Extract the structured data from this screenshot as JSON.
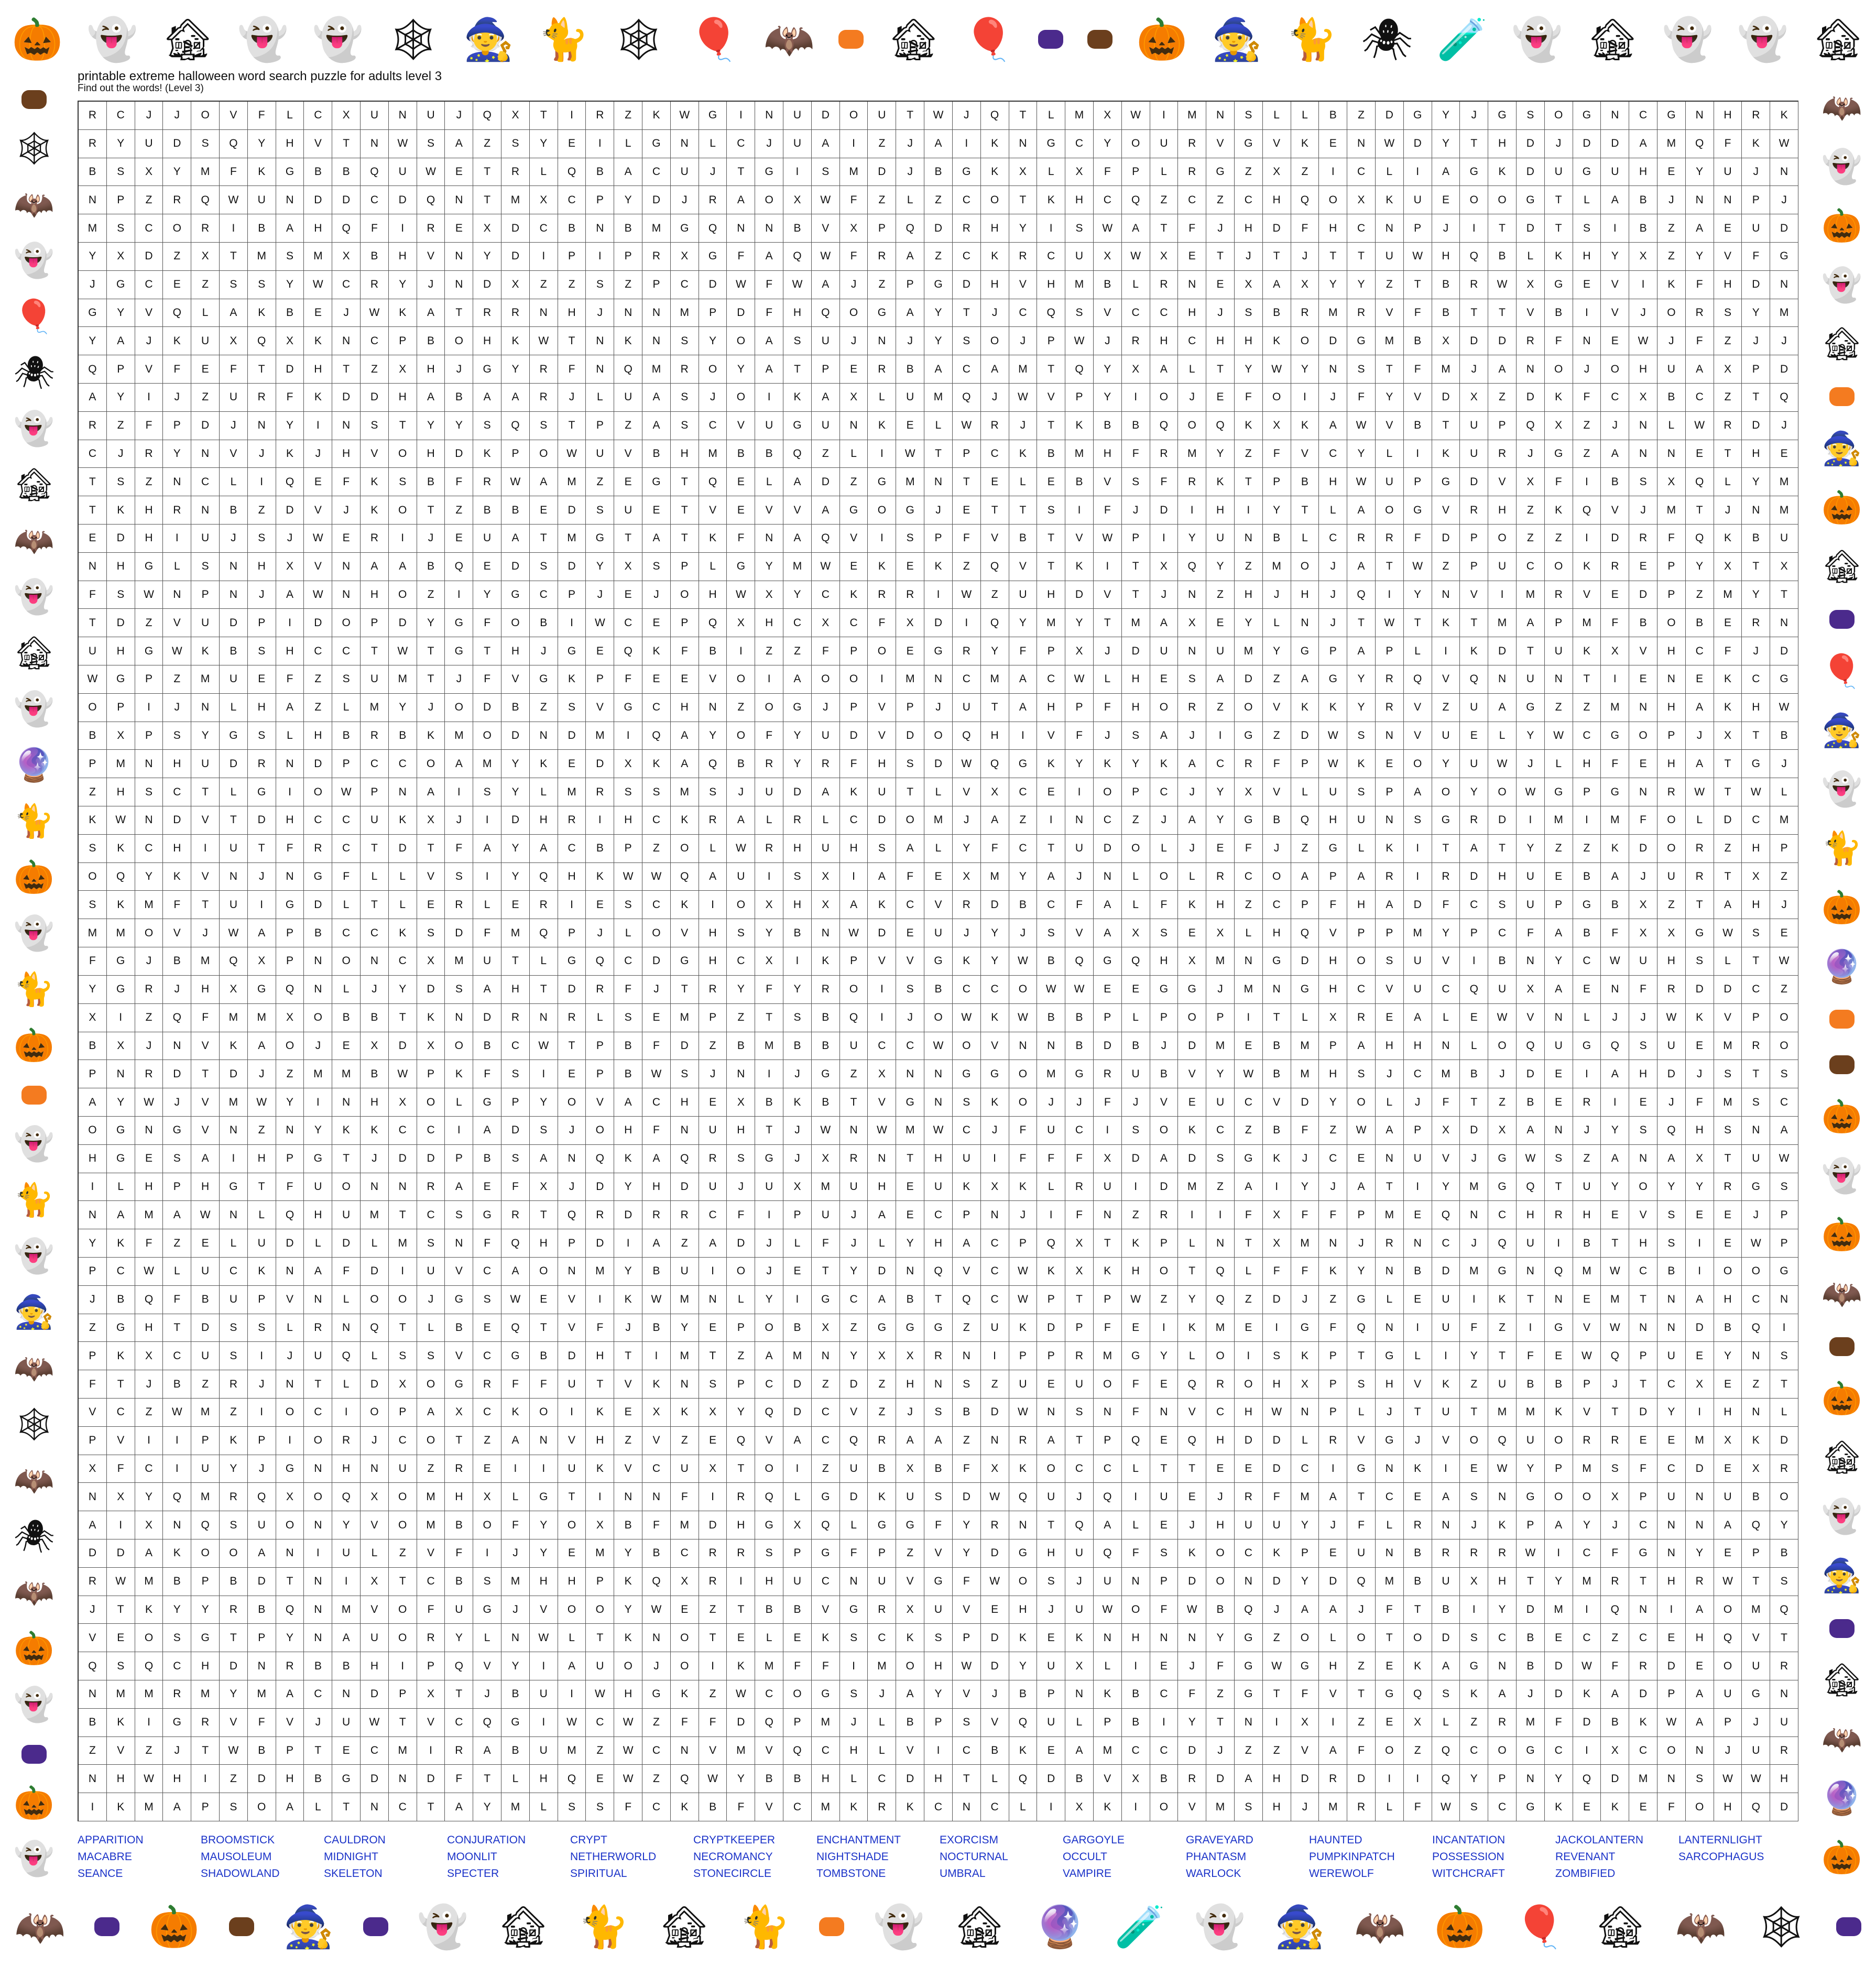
{
  "page": {
    "title": "printable extreme halloween word search puzzle for adults level 3",
    "subtitle": "Find out the words! (Level 3)"
  },
  "colors": {
    "word_list": "#1a32c8",
    "grid_lines": "#555555",
    "pumpkin_orange": "#f47b20",
    "halloween_purple": "#4b2a8c"
  },
  "decorations": {
    "top": [
      "pumpkin-row",
      "ghost",
      "haunted-house",
      "witch-ghost",
      "ghost",
      "spider-web",
      "witch",
      "cat",
      "spider-web",
      "balloon",
      "bats",
      "trick-or-treat",
      "haunted-house",
      "balloon",
      "happy-halloween",
      "halloween-sign",
      "pumpkin",
      "witch",
      "cat-pumpkin",
      "spider",
      "cauldron",
      "ghost",
      "haunted-house",
      "ghost",
      "ghost",
      "haunted-house"
    ],
    "bottom": [
      "bats",
      "happy-halloween",
      "pumpkin-row",
      "halloween-sign",
      "witch",
      "happy-halloween-pumpkins",
      "ghost",
      "haunted-house",
      "cat",
      "haunted-house",
      "cat-pumpkin",
      "trick-or-treat",
      "ghost",
      "haunted-house",
      "witch-hat",
      "cauldron",
      "ghost",
      "witch",
      "bats",
      "pumpkin",
      "balloon",
      "haunted-house",
      "bats",
      "spider-web",
      "happy-halloween"
    ],
    "left": [
      "halloween-sign",
      "spider-web",
      "bats",
      "ghost",
      "balloon",
      "spider",
      "ghost",
      "haunted-house",
      "bats",
      "ghost",
      "haunted-house",
      "ghost",
      "witch-hat",
      "cat",
      "pumpkin",
      "ghost",
      "cat-pumpkin",
      "pumpkin",
      "trick-or-treat",
      "ghost",
      "cat",
      "ghost",
      "witch",
      "bats",
      "spider-web",
      "bats",
      "spider",
      "bats",
      "pumpkin",
      "ghost",
      "happy-halloween",
      "pumpkin",
      "ghost"
    ],
    "right": [
      "bats",
      "ghost",
      "pumpkin",
      "ghost",
      "haunted-house",
      "trick-or-treat",
      "witch",
      "pumpkin",
      "haunted-house",
      "happy-halloween",
      "balloon",
      "witch",
      "ghost",
      "cat",
      "pumpkin",
      "witch-hat",
      "trick-or-treat",
      "halloween-sign",
      "pumpkin",
      "ghost",
      "pumpkin",
      "bats",
      "halloween-sign",
      "pumpkin",
      "haunted-house",
      "ghost",
      "witch",
      "happy-halloween",
      "haunted-house",
      "bats",
      "witch-hat",
      "pumpkin"
    ]
  },
  "grid": {
    "rows": [
      "RCJJOVFLCXUNUJQXTIRZKWGINUDOUTWJQTLMXWIMNSLLBZDGYJGSOGNCGNHRK",
      "RYUDSQYHVTNWSAZSYEILGNLCJUAIZJAIKNGCYOURVGVKENWDYTHDJDDAMQFKW",
      "BSXYMFKGBBQUWETRLQBACUJTGISMDJBGKXLXFPLRGZXZICLIAGKDUGUHEYUJN",
      "NPZRQWUNDDCDQNTMXCPYDJRAOXWFZLZCOTKHCQZCZCHQOXKUEOOGTLABJNNPJ",
      "MSCORIBAHQFIREXDCBNBMGQNNBVXPQDRHYISWATFJHDFHCNPJITDTSIBZAEUD",
      "YXDZXTMSMXBHVNYDIPIPRXGFAQWFRAZCKRCUXWXETJTJTTUWHQBLKHYXZYVFG",
      "JGCEZSSYWCRYJNDXZZSZPCDWFWAJZPGDHVHMBLRNEXAXYYZTBRWXGEVIKFHDN",
      "GYVQLAKBEJWKATRRNHJNNMPDFHQOGAYTJCQSVCCHJSBRMRVFBTTVBIVJORSYM",
      "YAJKUXQXKNCPBOHKWTNKNSYOASUJNJYSOJPWJRHCHHKODGMBXDDRFNEWJFZJJ",
      "QPVFEFTDHTZXHJGYRFNQMROYATPERBACAMTQYXALTYWYNSTFMJANOJOHUAXPD",
      "AYIJZURFKDDHABAARJLUASJOIKAXLUMQJWVPYIOJEFOIJFYVDXZDKFCXBCZTQ",
      "RZFPDJNYINSTYYSQSTPZASCVUGUNKELWRJTKBBQOQKXKAWVBTUPQXZJNLWRDJ",
      "CJRYNVJKJHVOHDKPOWUVBHMBBQZLIWTPCKBMHFRMYZFVCYLIKURJGZANNETHE",
      "TSZNCLIQEFKSBFRWAMZEGTQELADZGMNTELEBVSFRKTPBHWUPGDVXFIBSXQLYM",
      "TKHRNBZDVJKOTZBBEDSUETVEVVAGOGJETTSIFJDIHIYTLAOGVRHZKQVJMTJNM",
      "EDHIUJSJWERIJEUATMGTATKFNAQVISPFVBTVWPIYUNBLCRRFDPOZZIDRFQKBU",
      "NHGLSNHXVNAABQEDSDYXSPLGYMWEKEKZQVTKITXQYZMOJATWZPUCOKREPYXTX",
      "FSWNPNJAWNHOZIYGCPJEJOHWXYCKRRIWZUHDVTJNZHJHJQIYNVIMRVEDPZMYT",
      "TDZVUDPIDOPDYGFOBIWCEPQXHCXCFXDIQYMYTMAXEYLNJTWTKTMAPMFBOBERN",
      "UHGWKBSHCCTWTGTHJGEQKFBIZZFPOEGRYFPXJDUNUMYGPAPLIKDTUKXVHCFJD",
      "WGPZMUEFZSUMTJFVGKPFEEVOIAOOIMNCMACWLHESADZAGYRQVQNUNTIENEKCG",
      "OPIJNLHAZLMYJODBZSVGCHNZOGJPVPJUTAHPFHORZOVKKYRVZUAGZZMNHAKHW",
      "BXPSYGSLHBRBKMODNDMIQAYOFYUDVDOQHIVFJSAJIGZDWSNVUELYWCGOPJXTB",
      "PMNHUDRNDPCCOAMYKEDXKAQBRYRFHSDWQGKYKYKACRFPWKEOYUWJLHFEHATGJ",
      "ZHSCTLGIOWPNAISYLMRSSMSJUDAKUTLVXCEIOPCJYXVLUSPAOYOWGPGNRWTWL",
      "KWNDVTDHCCUKXJIDHRIHCKRALRLCDOMJAZINCZJAYGBQHUNSGRDIMIMFOLDCM",
      "SKCHIUTFRCTDTFAYACBPZOLWRHUHSALYFCTUDOLJEFJZGLKITATYZZKDORZHP",
      "OQYKVNJNGFLLVSIYQHKWWQAUISXIAFEXMYAJNLOLRCOAPARIRDHUEBAJURTXZ",
      "SKMFTUIGDLTLERLERIESCKIOXHXAKCVRDBCFALFKHZCPFHADFCSUPGBXZTAHJ",
      "MMOVJWAPBCCKSDFMQPJLOVHSYBNWDEUJYJSVAXSEXLHQVPPMYPCFABFXXGWSE",
      "FGJBMQXPNONCXMUTLGQCDGHCXIKPVVGKYWBQGQHXMNGDHOSUVIBNYCWUHSLTW",
      "YGRJHXGQNLJYDSAHTDRFJTRYFYROISBCCOWWEEGGJMNGHCVUCQUXAENFRDDCZ",
      "XIZQFMMXOBBTKNDRNRLSEMPZTSBQIJOWKWBBPLPOPITLXREALEWVNLJJWKVPO",
      "BXJNVKAOJEXDXOBCWTPBFDZBMBBUCCWOVNNBDBJDMEBMPAHHNLOQUGQSUEMRO",
      "PNRDTDJZMMBWPKFSIEPBWSJNIJGZXNNGGOMGRUBVYWBMHSJCMBJDEIAHDJSTS",
      "AYWJVMWYINHXOLGPYOVACHEXBKBTVGNSKOJJFJVEUCVDYOLJFTZBERIEJFMSC",
      "OGNGVNZNYKKCCIADSJOHFNUHTJWNWMWCJFUCISOKCZBFZWAPXDXANJYSQHSNA",
      "HGESAIHPGTJDDPBSANQKAQRSGJXRNTHUIFFFXDADSGKJCENUVJGWSZANAXTUW",
      "ILHPHGTFUONNRAEFXJDYHDUJUXMUHEUKXKLRUIDMZAIYJATIYMGQTUYOYYRGS",
      "NAMAWNLQHUMTCSGRTQRDRRCFIPUJAECPNJIFNZRIIFXFFPMEQNCHRHEVSEEJP",
      "YKFZELUDLDLMSNFQHPDIAZADJLFJLYHACPQXTKPLNTXMNJRNCJQUIBTHSIEWP",
      "PCWLUCKNAFDIUVCAONMYBUIOJETYDNQVCWKXKHOTQLFFKYNBDMGNQMWCBIOOG",
      "JBQFBUPVNLOOJGSWEVIKWMNLYIGCABTQCWPTPWZYQZDJZGLEUIKTNEMTNAHCN",
      "ZGHTDSSLRNQTLBEQTVFJBYEPOBXZGGGZUKDPFEIKMEIGFQNIUFZIGVWNNDBQI",
      "PKXCUSIJUQLSSVCGBDHTIMTZAMNYXXRNIPPRMGYLOISKPTGLIYTFEWQPUEYNS",
      "FTJBZRJNTLDXOGRFFUTVKNSPCDZDZHNSZUEUOFEQROHXPSHVKZUBBPJTCXEZT",
      "VCZWMZIOCIOPAXCKOIKEXKXYQDCVZJSBDWNSNFNVCHWNPLJTUTMMKVTDYIHNL",
      "PVIIPKPIORJCOTZANVHZVZEQVACQRAAZNRATPQEQHDDLRVGJVOQUORREEMXKD",
      "XFCIUYJGNHNUZREIIUKVCUXTOIZUBXBFXKOCCLTTEEDCIGNKIEWYPMSFCDEXR",
      "NXYQMRQXOQXOMHXLGTINNFIRQLGDKUSDWQUJQIUEJRFMATCEASNGOOXPUNUBO",
      "AIXNQSUONYVOMBOFYOXBFMDHGXQLGGFYRNTQALEJHUUYJFLRNJKPAYJCNNAQY",
      "DDAKOOANIULZVFIJYEMYBCRRSPGFPZVYDGHUQFSKOCKPEUNBRRRWICFGNYEPB",
      "RWMBPBDTNIXTCBSMHHPKQXRIHUCNUVGFWOSJUNPDONDYDQMBUXHTYMRTHRWTS",
      "JTKYYRBQNMVOFUGJVOOYWEZTBBVGRXUVEHJUWOFWBQJAAJFTBIYDMIQNIAOMQ",
      "VEOSGTPYNAUORYLNWLTKNOTELEKSCKSPDKEKNHNNYGZOLOTODSCBECZCEHQVT",
      "QSQCHDNRBBHIPQVYIAUOJOIKMFFIMOHWDYUXLIEJFGWGHZEKAGNBDWFRDEOUR",
      "NMMRMYMACNDPXTJBUIWHGKZWCOGSJAYVJBPNKBCFZGTFVTGQSKAJDKADPAUGN",
      "BKIGRVFVJUWTVCQGIWCWZFFDQPMJLBPSVQULPBIYTNIXIZEXLZRMFDBKWAPJU",
      "ZVZJTWBPTECMIRABUMZWCNVMVQCHLVICBKEAMCCDJZZVAFOZQCOGCIXCONJUR",
      "NHWHIZDHBGDNDFTLHQEWZQWYBBHLCDHTLQDBVXBRDAHDRDIIQYPNYQDMNSWWH",
      "IKMAPSOALTNCTAYMLSSFCKBFVCMKRKCNCLIXKIOVMSHJMRLFWSCGKEKEFOHQD"
    ]
  },
  "word_list": [
    "APPARITION",
    "BROOMSTICK",
    "CAULDRON",
    "CONJURATION",
    "CRYPT",
    "CRYPTKEEPER",
    "ENCHANTMENT",
    "EXORCISM",
    "GARGOYLE",
    "GRAVEYARD",
    "HAUNTED",
    "INCANTATION",
    "JACKOLANTERN",
    "LANTERNLIGHT",
    "MACABRE",
    "MAUSOLEUM",
    "MIDNIGHT",
    "MOONLIT",
    "NETHERWORLD",
    "NECROMANCY",
    "NIGHTSHADE",
    "NOCTURNAL",
    "OCCULT",
    "PHANTASM",
    "PUMPKINPATCH",
    "POSSESSION",
    "REVENANT",
    "SARCOPHAGUS",
    "SEANCE",
    "SHADOWLAND",
    "SKELETON",
    "SPECTER",
    "SPIRITUAL",
    "STONECIRCLE",
    "TOMBSTONE",
    "UMBRAL",
    "VAMPIRE",
    "WARLOCK",
    "WEREWOLF",
    "WITCHCRAFT",
    "ZOMBIFIED"
  ]
}
